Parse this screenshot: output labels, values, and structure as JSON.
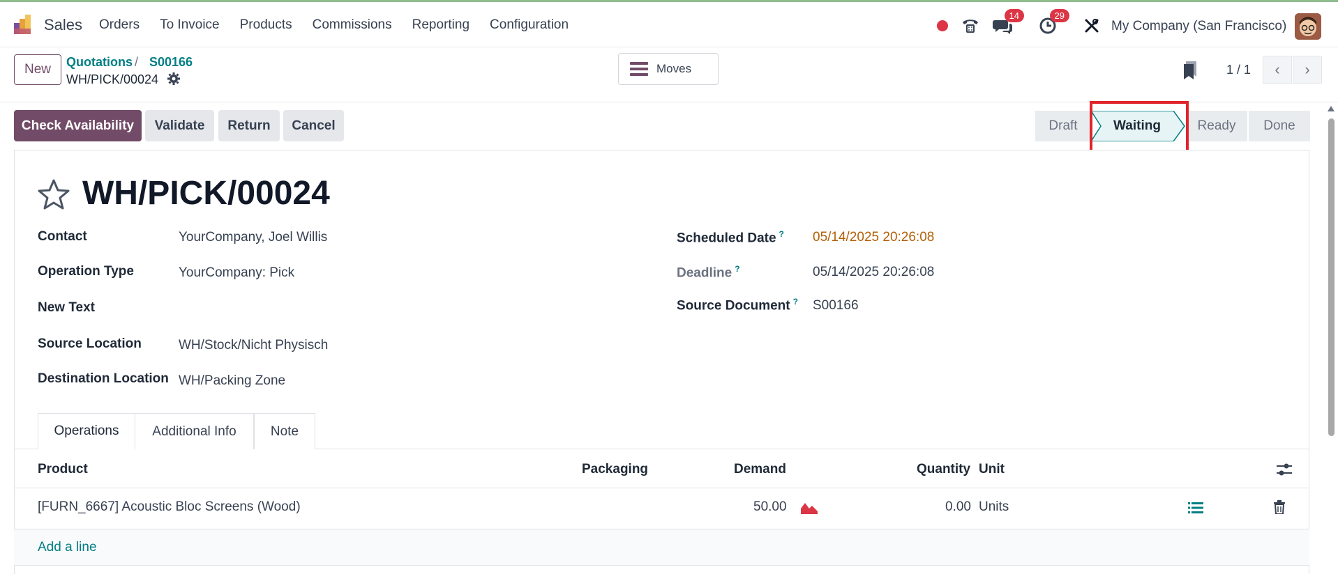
{
  "navbar": {
    "app_name": "Sales",
    "menu": [
      "Orders",
      "To Invoice",
      "Products",
      "Commissions",
      "Reporting",
      "Configuration"
    ],
    "messages_count": "14",
    "activities_count": "29",
    "company": "My Company (San Francisco)"
  },
  "control_panel": {
    "new_label": "New",
    "breadcrumb": [
      "Quotations",
      "S00166"
    ],
    "breadcrumb_sep": "/",
    "record_name": "WH/PICK/00024",
    "moves_label": "Moves",
    "pager": "1 / 1"
  },
  "actions": {
    "check_availability": "Check Availability",
    "validate": "Validate",
    "return": "Return",
    "cancel": "Cancel"
  },
  "statusbar": {
    "stages": [
      "Draft",
      "Waiting",
      "Ready",
      "Done"
    ],
    "active": "Waiting"
  },
  "form": {
    "title": "WH/PICK/00024",
    "contact_label": "Contact",
    "contact_value": "YourCompany, Joel Willis",
    "operation_type_label": "Operation Type",
    "operation_type_value": "YourCompany: Pick",
    "new_text_label": "New Text",
    "source_location_label": "Source Location",
    "source_location_value": "WH/Stock/Nicht Physisch",
    "destination_location_label": "Destination Location",
    "destination_location_value": "WH/Packing Zone",
    "scheduled_date_label": "Scheduled Date",
    "scheduled_date_value": "05/14/2025 20:26:08",
    "deadline_label": "Deadline",
    "deadline_value": "05/14/2025 20:26:08",
    "source_document_label": "Source Document",
    "source_document_value": "S00166",
    "help_mark": "?"
  },
  "tabs": [
    "Operations",
    "Additional Info",
    "Note"
  ],
  "table": {
    "columns": [
      "Product",
      "Packaging",
      "Demand",
      "Quantity",
      "Unit"
    ],
    "rows": [
      {
        "product": "[FURN_6667] Acoustic Bloc Screens (Wood)",
        "packaging": "",
        "demand": "50.00",
        "quantity": "0.00",
        "unit": "Units"
      }
    ],
    "add_line": "Add a line"
  },
  "colors": {
    "brand": "#714b67",
    "link": "#017e84",
    "highlight": "#e0242b",
    "date_warning": "#b45f06"
  }
}
